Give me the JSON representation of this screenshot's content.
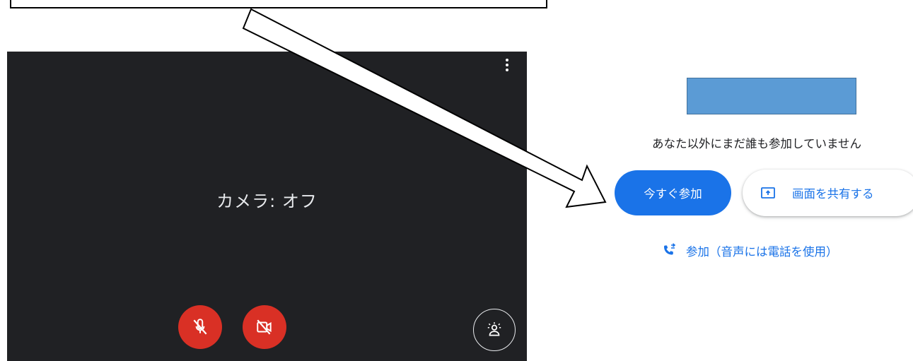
{
  "preview": {
    "camera_status": "カメラ: オフ",
    "more_icon": "more-vert-icon",
    "mic_icon": "mic-off-icon",
    "camera_icon": "videocam-off-icon",
    "effects_icon": "visual-effects-icon"
  },
  "join_panel": {
    "status": "あなた以外にまだ誰も参加していません",
    "join_now_label": "今すぐ参加",
    "share_screen_label": "画面を共有する",
    "share_icon": "present-to-all-icon",
    "phone_join_label": "参加（音声には電話を使用）",
    "phone_icon": "phone-forwarded-icon"
  },
  "colors": {
    "preview_bg": "#202124",
    "accent": "#1a73e8",
    "muted_red": "#d93025",
    "placeholder_fill": "#5b9bd5"
  }
}
